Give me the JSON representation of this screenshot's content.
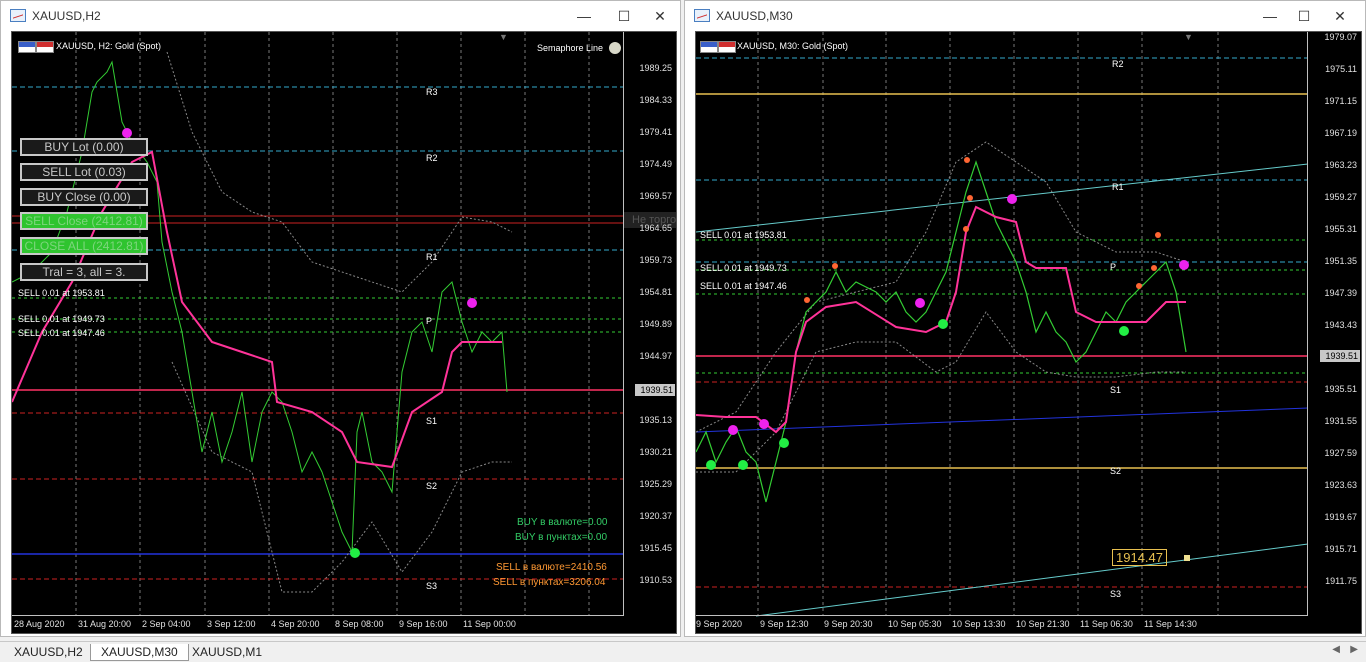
{
  "windows": {
    "left": {
      "title": "XAUUSD,H2",
      "chart_label": "XAUUSD, H2:  Gold (Spot)",
      "indicator_label": "Semaphore Line",
      "y_ticks": [
        "1989.25",
        "1984.33",
        "1979.41",
        "1974.49",
        "1969.57",
        "1964.65",
        "1959.73",
        "1954.81",
        "1949.89",
        "1944.97",
        "1939.51",
        "1935.13",
        "1930.21",
        "1925.29",
        "1920.37",
        "1915.45",
        "1910.53"
      ],
      "x_ticks": [
        "28 Aug 2020",
        "31 Aug 20:00",
        "2 Sep 04:00",
        "3 Sep 12:00",
        "4 Sep 20:00",
        "8 Sep 08:00",
        "9 Sep 16:00",
        "11 Sep 00:00"
      ],
      "current_price": "1939.51",
      "pivot_labels": [
        "R3",
        "R2",
        "R1",
        "P",
        "S1",
        "S2",
        "S3"
      ],
      "order_labels": [
        "SELL 0.01 at 1953.81",
        "SELL 0.01 at 1949.73",
        "SELL 0.01 at 1947.46"
      ],
      "panel_buttons": [
        {
          "label": "BUY Lot (0.00)",
          "style": "dark"
        },
        {
          "label": "SELL Lot (0.03)",
          "style": "dark"
        },
        {
          "label": "BUY Close (0.00)",
          "style": "dark"
        },
        {
          "label": "SELL Close (2412.81)",
          "style": "green"
        },
        {
          "label": "CLOSE ALL (2412.81)",
          "style": "green"
        },
        {
          "label": "Tral = 3, all = 3.",
          "style": "dark"
        }
      ],
      "stats": {
        "buy_currency": "BUY в валюте=0.00",
        "buy_points": "BUY в пунктах=0.00",
        "sell_currency": "SELL в валюте=2410.56",
        "sell_points": "SELL в пунктах=3206.04"
      },
      "overlay_text": "Не торговать сейчас"
    },
    "right": {
      "title": "XAUUSD,M30",
      "chart_label": "XAUUSD, M30:  Gold (Spot)",
      "y_ticks": [
        "1979.07",
        "1975.11",
        "1971.15",
        "1967.19",
        "1963.23",
        "1959.27",
        "1955.31",
        "1951.35",
        "1947.39",
        "1943.43",
        "1939.51",
        "1935.51",
        "1931.55",
        "1927.59",
        "1923.63",
        "1919.67",
        "1915.71",
        "1911.75"
      ],
      "x_ticks": [
        "9 Sep 2020",
        "9 Sep 12:30",
        "9 Sep 20:30",
        "10 Sep 05:30",
        "10 Sep 13:30",
        "10 Sep 21:30",
        "11 Sep 06:30",
        "11 Sep 14:30"
      ],
      "current_price": "1939.51",
      "pivot_labels": [
        "R2",
        "R1",
        "P",
        "S1",
        "S2",
        "S3"
      ],
      "order_labels": [
        "SELL 0.01 at 1953.81",
        "SELL 0.01 at 1949.73",
        "SELL 0.01 at 1947.46"
      ],
      "trendline_value": "1914.47"
    }
  },
  "status_tabs": [
    {
      "label": "XAUUSD,H2",
      "active": false
    },
    {
      "label": "XAUUSD,M30",
      "active": true
    },
    {
      "label": "XAUUSD,M1",
      "active": false
    }
  ],
  "colors": {
    "chart_bg": "#000000",
    "price_line": "#33cc33",
    "ma_line": "#ff3399",
    "pivot_line": "#33aacc",
    "support_line": "#cc2222",
    "dot_buy": "#22ee44",
    "dot_sell": "#ee22ee"
  }
}
